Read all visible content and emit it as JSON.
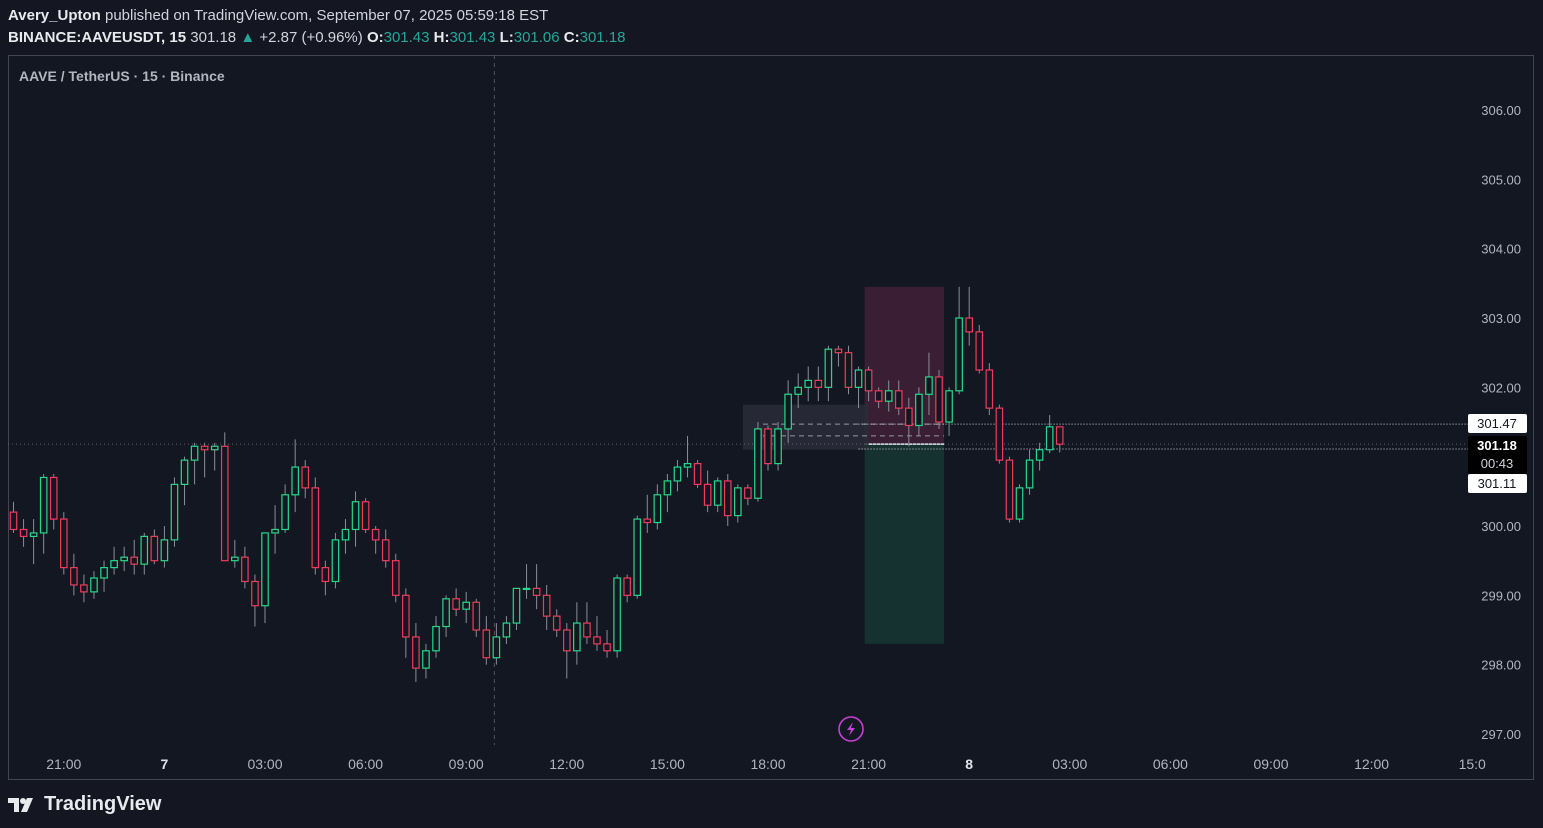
{
  "header": {
    "author": "Avery_Upton",
    "published_text": "published on TradingView.com, September 07, 2025 05:59:18 EST",
    "symbol_interval": "BINANCE:AAVEUSDT, 15",
    "last": "301.18",
    "change_arrow": "▲",
    "change": "+2.87 (+0.96%)",
    "o_label": "O:",
    "o_value": "301.43",
    "h_label": "H:",
    "h_value": "301.43",
    "l_label": "L:",
    "l_value": "301.06",
    "c_label": "C:",
    "c_value": "301.18"
  },
  "chart_title": "AAVE / TetherUS · 15 · Binance",
  "footer": {
    "brand": "TradingView"
  },
  "colors": {
    "up": "#26d98a",
    "down": "#ef3b5a",
    "background": "#131722",
    "axis_text": "#b2b5be",
    "stop_zone": "#3a1e33",
    "target_zone": "#153130",
    "accent_purple": "#c63fd6"
  },
  "chart_data": {
    "type": "candlestick",
    "title": "AAVE / TetherUS · 15 · Binance",
    "ylim": [
      296.8,
      306.4
    ],
    "y_ticks": [
      "306.00",
      "305.00",
      "304.00",
      "303.00",
      "302.00",
      "300.00",
      "299.00",
      "298.00",
      "297.00"
    ],
    "x_ticks": [
      "21:00",
      "7",
      "03:00",
      "06:00",
      "09:00",
      "12:00",
      "15:00",
      "18:00",
      "21:00",
      "8",
      "03:00",
      "06:00",
      "09:00",
      "12:00",
      "15:0"
    ],
    "x_tick_bars": [
      5,
      15,
      25,
      35,
      45,
      55,
      65,
      75,
      85,
      95,
      105,
      115,
      125,
      135,
      145
    ],
    "bold_ticks": [
      "7",
      "8"
    ],
    "price_labels": {
      "stop": "301.47",
      "current": "301.18",
      "countdown": "00:43",
      "target": "301.11"
    },
    "position": {
      "entry": 301.18,
      "stop": 303.45,
      "target": 298.3,
      "start_bar": 85,
      "end_bar": 92.5
    },
    "vertical_marker_bar": 47.8,
    "candles": [
      {
        "o": 300.2,
        "h": 300.35,
        "l": 299.9,
        "c": 299.95
      },
      {
        "o": 299.95,
        "h": 300.1,
        "l": 299.7,
        "c": 299.85
      },
      {
        "o": 299.85,
        "h": 300.1,
        "l": 299.45,
        "c": 299.9
      },
      {
        "o": 299.9,
        "h": 300.75,
        "l": 299.6,
        "c": 300.7
      },
      {
        "o": 300.7,
        "h": 300.75,
        "l": 299.95,
        "c": 300.1
      },
      {
        "o": 300.1,
        "h": 300.2,
        "l": 299.3,
        "c": 299.4
      },
      {
        "o": 299.4,
        "h": 299.6,
        "l": 299.0,
        "c": 299.15
      },
      {
        "o": 299.15,
        "h": 299.3,
        "l": 298.9,
        "c": 299.05
      },
      {
        "o": 299.05,
        "h": 299.35,
        "l": 298.95,
        "c": 299.25
      },
      {
        "o": 299.25,
        "h": 299.5,
        "l": 299.05,
        "c": 299.4
      },
      {
        "o": 299.4,
        "h": 299.7,
        "l": 299.3,
        "c": 299.5
      },
      {
        "o": 299.5,
        "h": 299.7,
        "l": 299.35,
        "c": 299.55
      },
      {
        "o": 299.55,
        "h": 299.8,
        "l": 299.3,
        "c": 299.45
      },
      {
        "o": 299.45,
        "h": 299.9,
        "l": 299.3,
        "c": 299.85
      },
      {
        "o": 299.85,
        "h": 299.95,
        "l": 299.45,
        "c": 299.5
      },
      {
        "o": 299.5,
        "h": 300.0,
        "l": 299.4,
        "c": 299.8
      },
      {
        "o": 299.8,
        "h": 300.7,
        "l": 299.7,
        "c": 300.6
      },
      {
        "o": 300.6,
        "h": 301.0,
        "l": 300.3,
        "c": 300.95
      },
      {
        "o": 300.95,
        "h": 301.2,
        "l": 300.6,
        "c": 301.15
      },
      {
        "o": 301.15,
        "h": 301.2,
        "l": 300.7,
        "c": 301.1
      },
      {
        "o": 301.1,
        "h": 301.2,
        "l": 300.8,
        "c": 301.15
      },
      {
        "o": 301.15,
        "h": 301.35,
        "l": 299.5,
        "c": 299.5
      },
      {
        "o": 299.5,
        "h": 299.8,
        "l": 299.4,
        "c": 299.55
      },
      {
        "o": 299.55,
        "h": 299.7,
        "l": 299.1,
        "c": 299.2
      },
      {
        "o": 299.2,
        "h": 299.3,
        "l": 298.55,
        "c": 298.85
      },
      {
        "o": 298.85,
        "h": 299.3,
        "l": 298.6,
        "c": 299.9
      },
      {
        "o": 299.9,
        "h": 300.3,
        "l": 299.6,
        "c": 299.95
      },
      {
        "o": 299.95,
        "h": 300.6,
        "l": 299.9,
        "c": 300.45
      },
      {
        "o": 300.45,
        "h": 301.25,
        "l": 300.2,
        "c": 300.85
      },
      {
        "o": 300.85,
        "h": 300.95,
        "l": 300.4,
        "c": 300.55
      },
      {
        "o": 300.55,
        "h": 300.7,
        "l": 299.3,
        "c": 299.4
      },
      {
        "o": 299.4,
        "h": 299.5,
        "l": 299.0,
        "c": 299.2
      },
      {
        "o": 299.2,
        "h": 299.9,
        "l": 299.1,
        "c": 299.8
      },
      {
        "o": 299.8,
        "h": 300.1,
        "l": 299.6,
        "c": 299.95
      },
      {
        "o": 299.95,
        "h": 300.5,
        "l": 299.7,
        "c": 300.35
      },
      {
        "o": 300.35,
        "h": 300.4,
        "l": 299.9,
        "c": 299.95
      },
      {
        "o": 299.95,
        "h": 300.0,
        "l": 299.6,
        "c": 299.8
      },
      {
        "o": 299.8,
        "h": 299.95,
        "l": 299.4,
        "c": 299.5
      },
      {
        "o": 299.5,
        "h": 299.6,
        "l": 298.9,
        "c": 299.0
      },
      {
        "o": 299.0,
        "h": 299.1,
        "l": 298.1,
        "c": 298.4
      },
      {
        "o": 298.4,
        "h": 298.6,
        "l": 297.75,
        "c": 297.95
      },
      {
        "o": 297.95,
        "h": 298.3,
        "l": 297.8,
        "c": 298.2
      },
      {
        "o": 298.2,
        "h": 298.7,
        "l": 298.1,
        "c": 298.55
      },
      {
        "o": 298.55,
        "h": 299.0,
        "l": 298.4,
        "c": 298.95
      },
      {
        "o": 298.95,
        "h": 299.1,
        "l": 298.7,
        "c": 298.8
      },
      {
        "o": 298.8,
        "h": 299.05,
        "l": 298.6,
        "c": 298.9
      },
      {
        "o": 298.9,
        "h": 298.95,
        "l": 298.4,
        "c": 298.5
      },
      {
        "o": 298.5,
        "h": 298.7,
        "l": 298.0,
        "c": 298.1
      },
      {
        "o": 298.1,
        "h": 298.6,
        "l": 298.0,
        "c": 298.4
      },
      {
        "o": 298.4,
        "h": 298.7,
        "l": 298.3,
        "c": 298.6
      },
      {
        "o": 298.6,
        "h": 299.1,
        "l": 298.5,
        "c": 299.1
      },
      {
        "o": 299.1,
        "h": 299.45,
        "l": 298.95,
        "c": 299.1
      },
      {
        "o": 299.1,
        "h": 299.45,
        "l": 298.8,
        "c": 299.0
      },
      {
        "o": 299.0,
        "h": 299.15,
        "l": 298.5,
        "c": 298.7
      },
      {
        "o": 298.7,
        "h": 298.8,
        "l": 298.4,
        "c": 298.5
      },
      {
        "o": 298.5,
        "h": 298.6,
        "l": 297.8,
        "c": 298.2
      },
      {
        "o": 298.2,
        "h": 298.9,
        "l": 298.0,
        "c": 298.6
      },
      {
        "o": 298.6,
        "h": 298.9,
        "l": 298.3,
        "c": 298.4
      },
      {
        "o": 298.4,
        "h": 298.7,
        "l": 298.2,
        "c": 298.3
      },
      {
        "o": 298.3,
        "h": 298.5,
        "l": 298.1,
        "c": 298.2
      },
      {
        "o": 298.2,
        "h": 299.3,
        "l": 298.1,
        "c": 299.25
      },
      {
        "o": 299.25,
        "h": 299.3,
        "l": 298.9,
        "c": 299.0
      },
      {
        "o": 299.0,
        "h": 300.15,
        "l": 298.95,
        "c": 300.1
      },
      {
        "o": 300.1,
        "h": 300.45,
        "l": 299.9,
        "c": 300.05
      },
      {
        "o": 300.05,
        "h": 300.6,
        "l": 299.95,
        "c": 300.45
      },
      {
        "o": 300.45,
        "h": 300.75,
        "l": 300.2,
        "c": 300.65
      },
      {
        "o": 300.65,
        "h": 300.95,
        "l": 300.5,
        "c": 300.85
      },
      {
        "o": 300.85,
        "h": 301.3,
        "l": 300.7,
        "c": 300.9
      },
      {
        "o": 300.9,
        "h": 300.95,
        "l": 300.55,
        "c": 300.6
      },
      {
        "o": 300.6,
        "h": 300.8,
        "l": 300.2,
        "c": 300.3
      },
      {
        "o": 300.3,
        "h": 300.7,
        "l": 300.2,
        "c": 300.65
      },
      {
        "o": 300.65,
        "h": 300.75,
        "l": 300.0,
        "c": 300.15
      },
      {
        "o": 300.15,
        "h": 300.6,
        "l": 300.05,
        "c": 300.55
      },
      {
        "o": 300.55,
        "h": 300.6,
        "l": 300.3,
        "c": 300.4
      },
      {
        "o": 300.4,
        "h": 301.5,
        "l": 300.35,
        "c": 301.4
      },
      {
        "o": 301.4,
        "h": 301.45,
        "l": 300.8,
        "c": 300.9
      },
      {
        "o": 300.9,
        "h": 301.5,
        "l": 300.8,
        "c": 301.4
      },
      {
        "o": 301.4,
        "h": 302.1,
        "l": 301.2,
        "c": 301.9
      },
      {
        "o": 301.9,
        "h": 302.2,
        "l": 301.7,
        "c": 302.0
      },
      {
        "o": 302.0,
        "h": 302.3,
        "l": 301.8,
        "c": 302.1
      },
      {
        "o": 302.1,
        "h": 302.3,
        "l": 301.8,
        "c": 302.0
      },
      {
        "o": 302.0,
        "h": 302.6,
        "l": 301.8,
        "c": 302.55
      },
      {
        "o": 302.55,
        "h": 302.6,
        "l": 302.3,
        "c": 302.5
      },
      {
        "o": 302.5,
        "h": 302.6,
        "l": 301.9,
        "c": 302.0
      },
      {
        "o": 302.0,
        "h": 302.3,
        "l": 301.7,
        "c": 302.25
      },
      {
        "o": 302.25,
        "h": 302.3,
        "l": 301.8,
        "c": 301.95
      },
      {
        "o": 301.95,
        "h": 302.0,
        "l": 301.7,
        "c": 301.8
      },
      {
        "o": 301.8,
        "h": 302.1,
        "l": 301.65,
        "c": 301.95
      },
      {
        "o": 301.95,
        "h": 302.1,
        "l": 301.6,
        "c": 301.7
      },
      {
        "o": 301.7,
        "h": 301.85,
        "l": 301.15,
        "c": 301.45
      },
      {
        "o": 301.45,
        "h": 302.0,
        "l": 301.3,
        "c": 301.9
      },
      {
        "o": 301.9,
        "h": 302.5,
        "l": 301.6,
        "c": 302.15
      },
      {
        "o": 302.15,
        "h": 302.25,
        "l": 301.4,
        "c": 301.5
      },
      {
        "o": 301.5,
        "h": 302.0,
        "l": 301.3,
        "c": 301.95
      },
      {
        "o": 301.95,
        "h": 303.45,
        "l": 301.9,
        "c": 303.0
      },
      {
        "o": 303.0,
        "h": 303.45,
        "l": 302.6,
        "c": 302.8
      },
      {
        "o": 302.8,
        "h": 302.9,
        "l": 302.2,
        "c": 302.25
      },
      {
        "o": 302.25,
        "h": 302.35,
        "l": 301.6,
        "c": 301.7
      },
      {
        "o": 301.7,
        "h": 301.75,
        "l": 300.9,
        "c": 300.95
      },
      {
        "o": 300.95,
        "h": 301.0,
        "l": 300.05,
        "c": 300.1
      },
      {
        "o": 300.1,
        "h": 300.6,
        "l": 300.05,
        "c": 300.55
      },
      {
        "o": 300.55,
        "h": 301.1,
        "l": 300.45,
        "c": 300.95
      },
      {
        "o": 300.95,
        "h": 301.2,
        "l": 300.8,
        "c": 301.1
      },
      {
        "o": 301.1,
        "h": 301.6,
        "l": 301.05,
        "c": 301.43
      },
      {
        "o": 301.43,
        "h": 301.43,
        "l": 301.06,
        "c": 301.18
      }
    ]
  }
}
